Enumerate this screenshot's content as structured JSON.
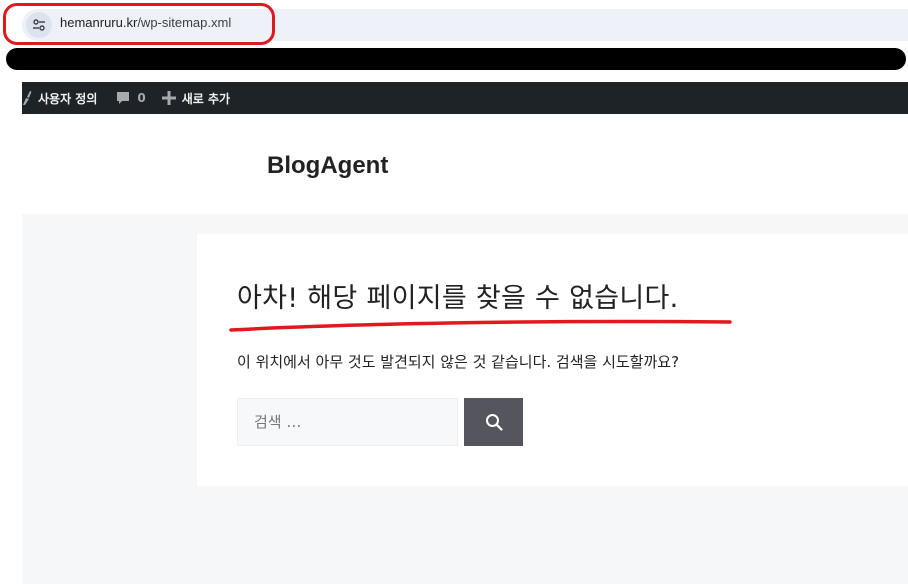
{
  "browser": {
    "url_host": "hemanruru.kr",
    "url_path": "/wp-sitemap.xml"
  },
  "admin_bar": {
    "customize_label": "사용자 정의",
    "comments_count": "0",
    "new_label": "새로 추가",
    "background": "#1d2327"
  },
  "site": {
    "title": "BlogAgent"
  },
  "page": {
    "heading": "아차! 해당 페이지를 찾을 수 없습니다.",
    "message": "이 위치에서 아무 것도 발견되지 않은 것 같습니다. 검색을 시도할까요?"
  },
  "search": {
    "placeholder": "검색 …",
    "button_icon": "search-icon",
    "button_color": "#55555e"
  },
  "annotation_color": "#e0191f"
}
